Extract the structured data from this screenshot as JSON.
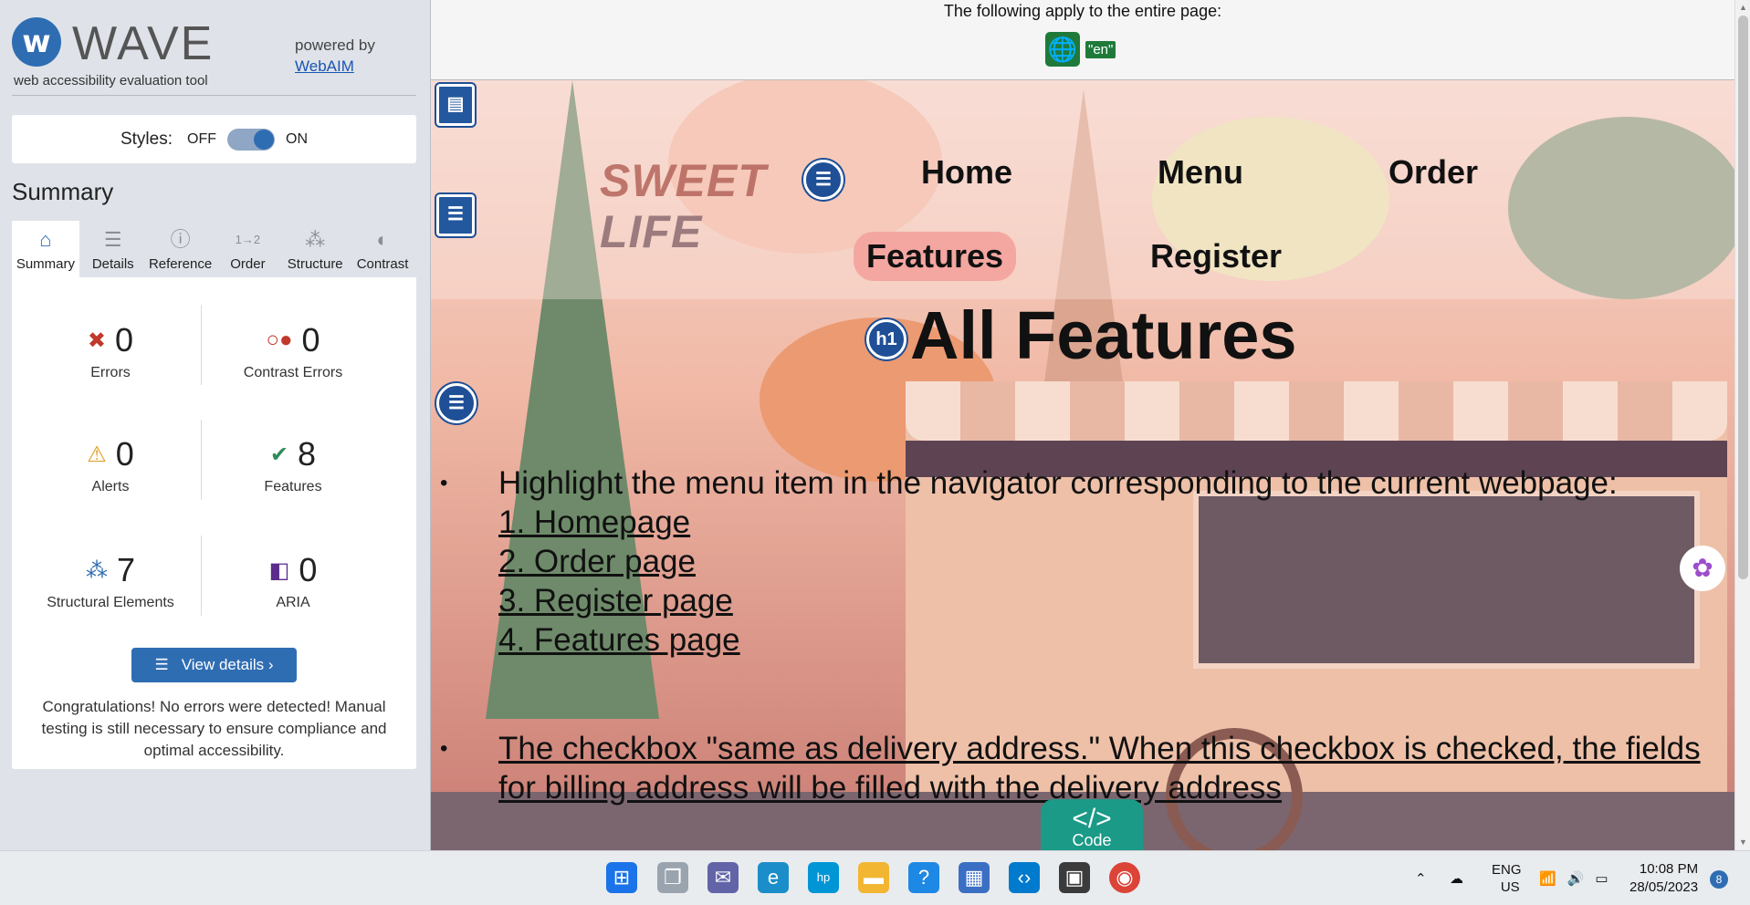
{
  "sidebar": {
    "brand": "WAVE",
    "subtitle": "web accessibility evaluation tool",
    "powered_by": "powered by",
    "powered_link": "WebAIM",
    "styles_label": "Styles:",
    "styles_off": "OFF",
    "styles_on": "ON",
    "summary_heading": "Summary",
    "tabs": [
      {
        "label": "Summary",
        "icon": "home-icon"
      },
      {
        "label": "Details",
        "icon": "list-icon"
      },
      {
        "label": "Reference",
        "icon": "info-icon"
      },
      {
        "label": "Order",
        "icon": "order-icon"
      },
      {
        "label": "Structure",
        "icon": "structure-icon"
      },
      {
        "label": "Contrast",
        "icon": "contrast-icon"
      }
    ],
    "stats": [
      {
        "count": "0",
        "label": "Errors",
        "icon": "error-icon",
        "color": "#c0392b"
      },
      {
        "count": "0",
        "label": "Contrast Errors",
        "icon": "contrast-error-icon",
        "color": "#c0392b"
      },
      {
        "count": "0",
        "label": "Alerts",
        "icon": "alert-icon",
        "color": "#e09b1f"
      },
      {
        "count": "8",
        "label": "Features",
        "icon": "feature-check-icon",
        "color": "#2e8b57"
      },
      {
        "count": "7",
        "label": "Structural Elements",
        "icon": "structure-icon",
        "color": "#2f6db3"
      },
      {
        "count": "0",
        "label": "ARIA",
        "icon": "aria-icon",
        "color": "#5b2c8c"
      }
    ],
    "view_details": "View details ›",
    "congrats": "Congratulations! No errors were detected! Manual testing is still necessary to ensure compliance and optimal accessibility."
  },
  "page_note": {
    "text": "The following apply to the entire page:",
    "lang_badge": "\"en\""
  },
  "site": {
    "logo_line1": "SWEET",
    "logo_line2": "LIFE",
    "nav": [
      "Home",
      "Menu",
      "Order",
      "Features",
      "Register"
    ],
    "h1_badge": "h1",
    "heading": "All Features",
    "item1_text": "Highlight the menu item in the navigator corresponding to the current webpage:",
    "item1_links": [
      "1. Homepage",
      "2. Order page",
      "3. Register page",
      "4. Features page"
    ],
    "item2_text": "The checkbox \"same as delivery address.\" When this checkbox is checked, the fields for billing address will be filled with the delivery address",
    "code_label": "Code",
    "code_symbol": "</>"
  },
  "taskbar": {
    "lang_top": "ENG",
    "lang_bottom": "US",
    "time": "10:08 PM",
    "date": "28/05/2023",
    "notif_count": "8",
    "apps": [
      "start-icon",
      "task-view-icon",
      "chat-icon",
      "edge-icon",
      "myhp-icon",
      "file-explorer-icon",
      "help-icon",
      "store-icon",
      "vscode-icon",
      "app-icon",
      "chrome-icon"
    ]
  }
}
